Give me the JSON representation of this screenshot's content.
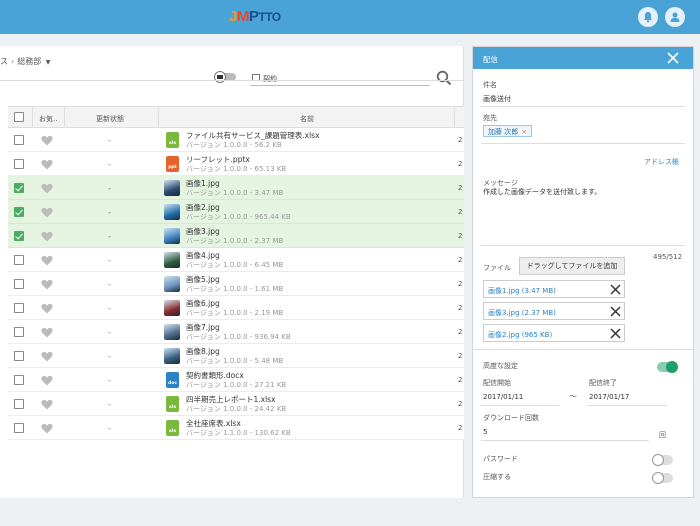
{
  "header": {
    "logo_j": "J",
    "logo_m": "M",
    "logo_rest": "P",
    "logo_ptto": "TTO"
  },
  "breadcrumb": {
    "prev": "ス",
    "current": "総務部"
  },
  "search": {
    "value": "契約"
  },
  "table": {
    "headers": [
      "お気..",
      "更新状態",
      "名前"
    ],
    "rows": [
      {
        "checked": false,
        "status": "-",
        "name": "ファイル共有サービス_課題管理表.xlsx",
        "version": "バージョン 1.0.0.0 - 56.2 KB",
        "type": "xls",
        "edge": "2"
      },
      {
        "checked": false,
        "status": "-",
        "name": "リーフレット.pptx",
        "version": "バージョン 1.0.0.0 - 65.13 KB",
        "type": "ppt",
        "edge": "2"
      },
      {
        "checked": true,
        "status": "-",
        "name": "画像1.jpg",
        "version": "バージョン 1.0.0.0 - 3.47 MB",
        "type": "img",
        "edge": "2"
      },
      {
        "checked": true,
        "status": "-",
        "name": "画像2.jpg",
        "version": "バージョン 1.0.0.0 - 965.44 KB",
        "type": "img",
        "edge": "2"
      },
      {
        "checked": true,
        "status": "-",
        "name": "画像3.jpg",
        "version": "バージョン 1.0.0.0 - 2.37 MB",
        "type": "img",
        "edge": "2"
      },
      {
        "checked": false,
        "status": "-",
        "name": "画像4.jpg",
        "version": "バージョン 1.0.0.0 - 6.45 MB",
        "type": "img",
        "edge": "2"
      },
      {
        "checked": false,
        "status": "-",
        "name": "画像5.jpg",
        "version": "バージョン 1.0.0.0 - 1.61 MB",
        "type": "img",
        "edge": "2"
      },
      {
        "checked": false,
        "status": "-",
        "name": "画像6.jpg",
        "version": "バージョン 1.0.0.0 - 2.19 MB",
        "type": "img",
        "edge": "2"
      },
      {
        "checked": false,
        "status": "-",
        "name": "画像7.jpg",
        "version": "バージョン 1.0.0.0 - 936.94 KB",
        "type": "img",
        "edge": "2"
      },
      {
        "checked": false,
        "status": "-",
        "name": "画像8.jpg",
        "version": "バージョン 1.0.0.0 - 5.48 MB",
        "type": "img",
        "edge": "2"
      },
      {
        "checked": false,
        "status": "-",
        "name": "契約書類形.docx",
        "version": "バージョン 1.0.0.0 - 27.21 KB",
        "type": "doc",
        "edge": "2"
      },
      {
        "checked": false,
        "status": "-",
        "name": "四半期売上レポート1.xlsx",
        "version": "バージョン 1.0.0.0 - 24.42 KB",
        "type": "xls",
        "edge": "2"
      },
      {
        "checked": false,
        "status": "-",
        "name": "全社座席表.xlsx",
        "version": "バージョン 1.1.0.0 - 130.62 KB",
        "type": "xls",
        "edge": "2"
      }
    ]
  },
  "panel": {
    "title": "配信",
    "subject_label": "件名",
    "subject_value": "画像送付",
    "to_label": "宛先",
    "recipient": "加藤 次郎",
    "recipient_remove": "×",
    "address_book": "アドレス帳",
    "message_label": "メッセージ",
    "message_value": "作成した画像データを送付致します。",
    "char_count": "495/512",
    "file_label": "ファイル",
    "add_file_button": "ドラッグしてファイルを追加",
    "attachments": [
      "画像1.jpg (3.47 MB)",
      "画像3.jpg (2.37 MB)",
      "画像2.jpg (965 KB)"
    ],
    "advanced_label": "高度な設定",
    "advanced_on": true,
    "start_label": "配信開始",
    "start_value": "2017/01/11",
    "range_sep": "〜",
    "end_label": "配信終了",
    "end_value": "2017/01/17",
    "download_label": "ダウンロード回数",
    "download_value": "5",
    "download_unit": "回",
    "password_label": "パスワード",
    "password_on": false,
    "compress_label": "圧縮する",
    "compress_on": false
  },
  "colors": {
    "header": "#4aa3d6",
    "selected_row": "#e4f4e0",
    "checkbox_on": "#4aae62",
    "xls": "#7ab93b",
    "ppt": "#e4622b",
    "doc": "#2a83c7",
    "toggle_on": "#1f9e6a"
  }
}
